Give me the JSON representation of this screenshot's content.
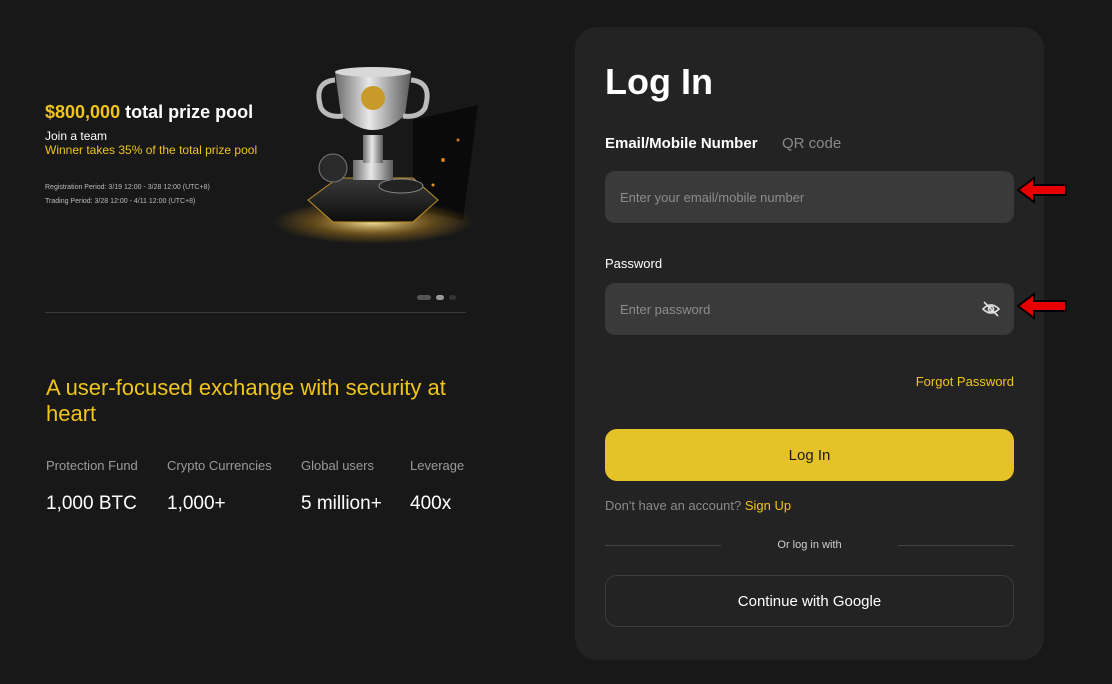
{
  "banner": {
    "prize_amount": "$800,000",
    "prize_text": " total prize pool",
    "line1": "Join a team",
    "line2": "Winner takes 35% of the total prize pool",
    "registration": "Registration Period: 3/19  12:00 - 3/28  12:00  (UTC+8)",
    "trading": "Trading Period: 3/28  12:00 - 4/11 12:00  (UTC+8)"
  },
  "tagline": "A user-focused exchange with security at heart",
  "stats": [
    {
      "label": "Protection Fund",
      "value": "1,000 BTC"
    },
    {
      "label": "Crypto Currencies",
      "value": "1,000+"
    },
    {
      "label": "Global users",
      "value": "5 million+"
    },
    {
      "label": "Leverage",
      "value": "400x"
    }
  ],
  "login": {
    "title": "Log In",
    "tabs": [
      {
        "label": "Email/Mobile Number",
        "active": true
      },
      {
        "label": "QR code",
        "active": false
      }
    ],
    "email_placeholder": "Enter your email/mobile number",
    "email_value": "",
    "password_label": "Password",
    "password_placeholder": "Enter password",
    "password_value": "",
    "forgot_password": "Forgot Password",
    "login_button": "Log In",
    "no_account": "Don't have an account? ",
    "sign_up": "Sign Up",
    "or_login_with": "Or log in with",
    "google_button": "Continue with Google"
  },
  "icons": {
    "password_toggle": "eye-slash-icon",
    "annotation": "red-arrow-icon"
  },
  "colors": {
    "accent": "#f0c419",
    "button": "#e6c229",
    "background": "#181818",
    "card": "#232323",
    "input": "#3a3a3a",
    "annotation": "#e60000"
  }
}
